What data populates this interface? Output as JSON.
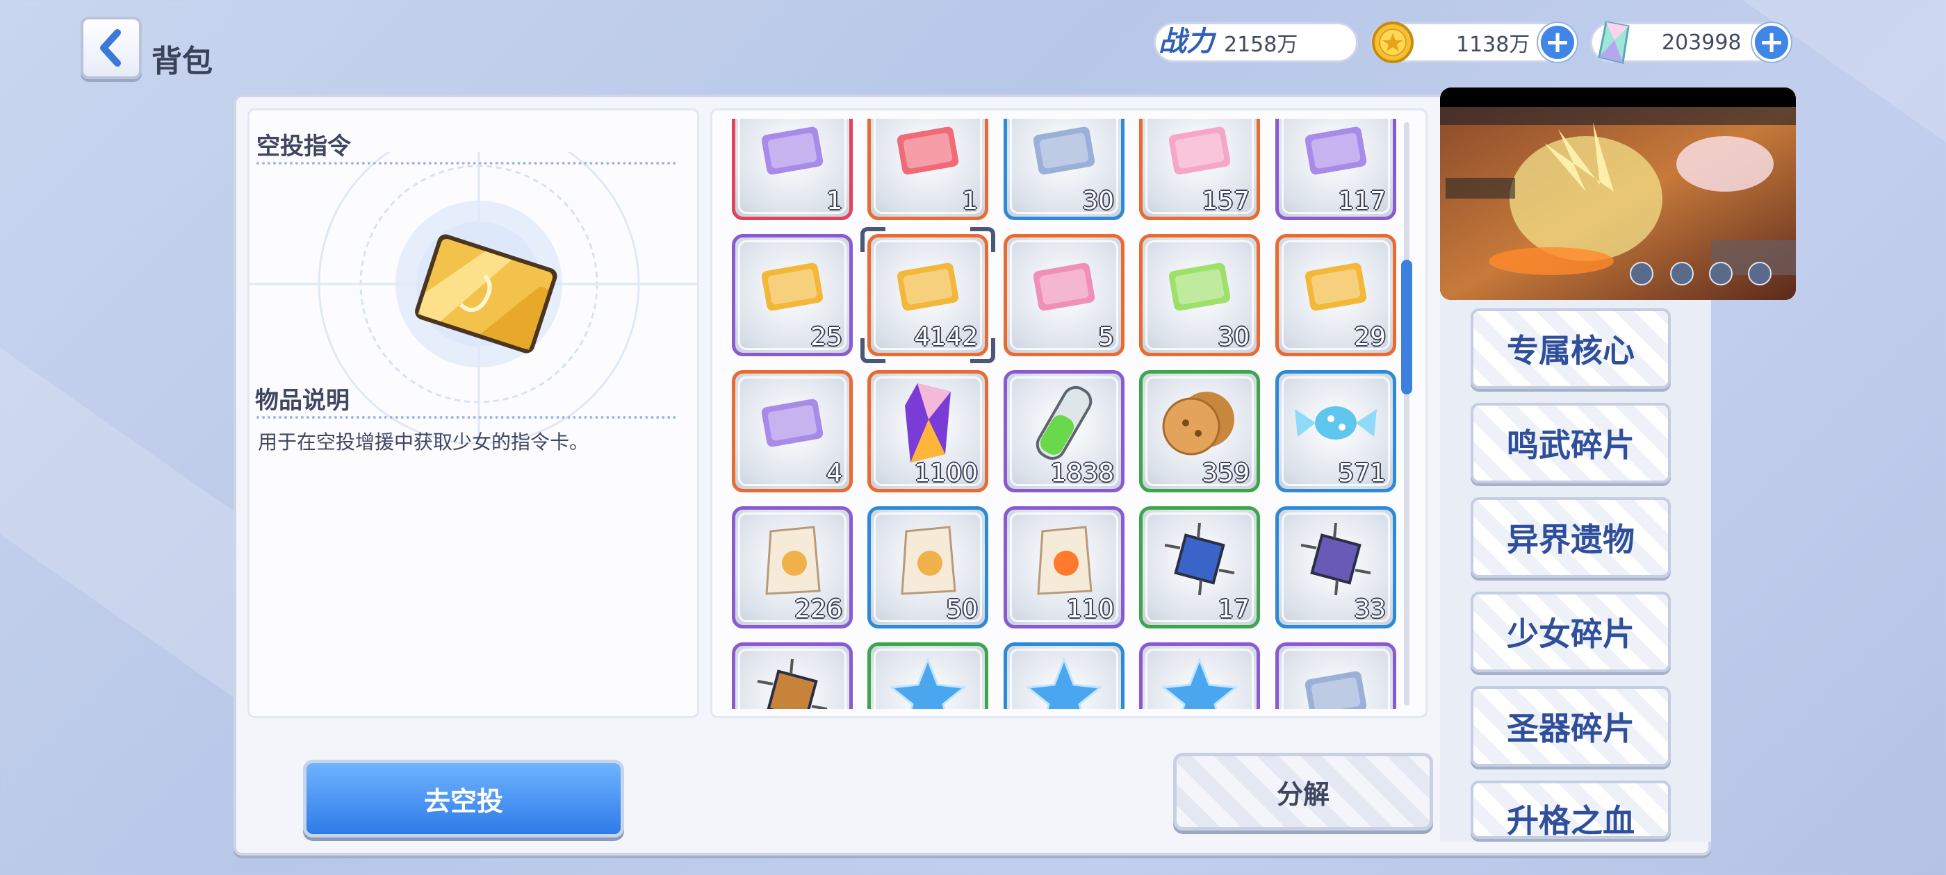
{
  "header": {
    "title": "背包"
  },
  "resources": {
    "power_label": "战力",
    "power": "2158万",
    "gold": "1138万",
    "gems": "203998"
  },
  "detail": {
    "item_name": "空投指令",
    "desc_title": "物品说明",
    "description": "用于在空投增援中获取少女的指令卡。"
  },
  "items": [
    {
      "count": "1",
      "icon": "crystal-box-icon",
      "rarity": "red"
    },
    {
      "count": "1",
      "icon": "red-ticket-icon",
      "rarity": "orange"
    },
    {
      "count": "30",
      "icon": "amulet-icon",
      "rarity": "blue"
    },
    {
      "count": "157",
      "icon": "shirt-ticket-icon",
      "rarity": "orange"
    },
    {
      "count": "117",
      "icon": "smile-ticket-icon",
      "rarity": "purple"
    },
    {
      "count": "25",
      "icon": "dna-card-icon",
      "rarity": "purple"
    },
    {
      "count": "4142",
      "icon": "airdrop-card-icon",
      "rarity": "orange"
    },
    {
      "count": "5",
      "icon": "pink-dna-card-icon",
      "rarity": "orange"
    },
    {
      "count": "30",
      "icon": "rainbow-ticket-icon",
      "rarity": "orange"
    },
    {
      "count": "29",
      "icon": "sword-card-icon",
      "rarity": "orange"
    },
    {
      "count": "4",
      "icon": "sword-card-purple-icon",
      "rarity": "orange"
    },
    {
      "count": "1100",
      "icon": "gem-crystal-icon",
      "rarity": "orange"
    },
    {
      "count": "1838",
      "icon": "potion-tube-icon",
      "rarity": "purple"
    },
    {
      "count": "359",
      "icon": "cookie-icon",
      "rarity": "green"
    },
    {
      "count": "571",
      "icon": "candy-icon",
      "rarity": "blue"
    },
    {
      "count": "226",
      "icon": "can-food-icon",
      "rarity": "purple"
    },
    {
      "count": "50",
      "icon": "snack-bag-icon",
      "rarity": "blue"
    },
    {
      "count": "110",
      "icon": "carrot-bag-icon",
      "rarity": "purple"
    },
    {
      "count": "17",
      "icon": "chip-blue-icon",
      "rarity": "green"
    },
    {
      "count": "33",
      "icon": "chip-purple-icon",
      "rarity": "blue"
    },
    {
      "count": "",
      "icon": "chip-gold-icon",
      "rarity": "purple"
    },
    {
      "count": "",
      "icon": "ice-crystal-icon",
      "rarity": "green"
    },
    {
      "count": "",
      "icon": "ice-star-icon",
      "rarity": "blue"
    },
    {
      "count": "",
      "icon": "ice-star-icon",
      "rarity": "purple"
    },
    {
      "count": "",
      "icon": "helmet-icon",
      "rarity": "purple"
    }
  ],
  "buttons": {
    "go_airdrop": "去空投",
    "decompose": "分解"
  },
  "categories": [
    "专属核心",
    "鸣武碎片",
    "异界遗物",
    "少女碎片",
    "圣器碎片",
    "升格之血"
  ],
  "colors": {
    "red": "#e0435b",
    "orange": "#ea6a2f",
    "blue": "#2d8ad6",
    "purple": "#8b5ad0",
    "green": "#3ea64a",
    "accent": "#3d7fe0"
  }
}
